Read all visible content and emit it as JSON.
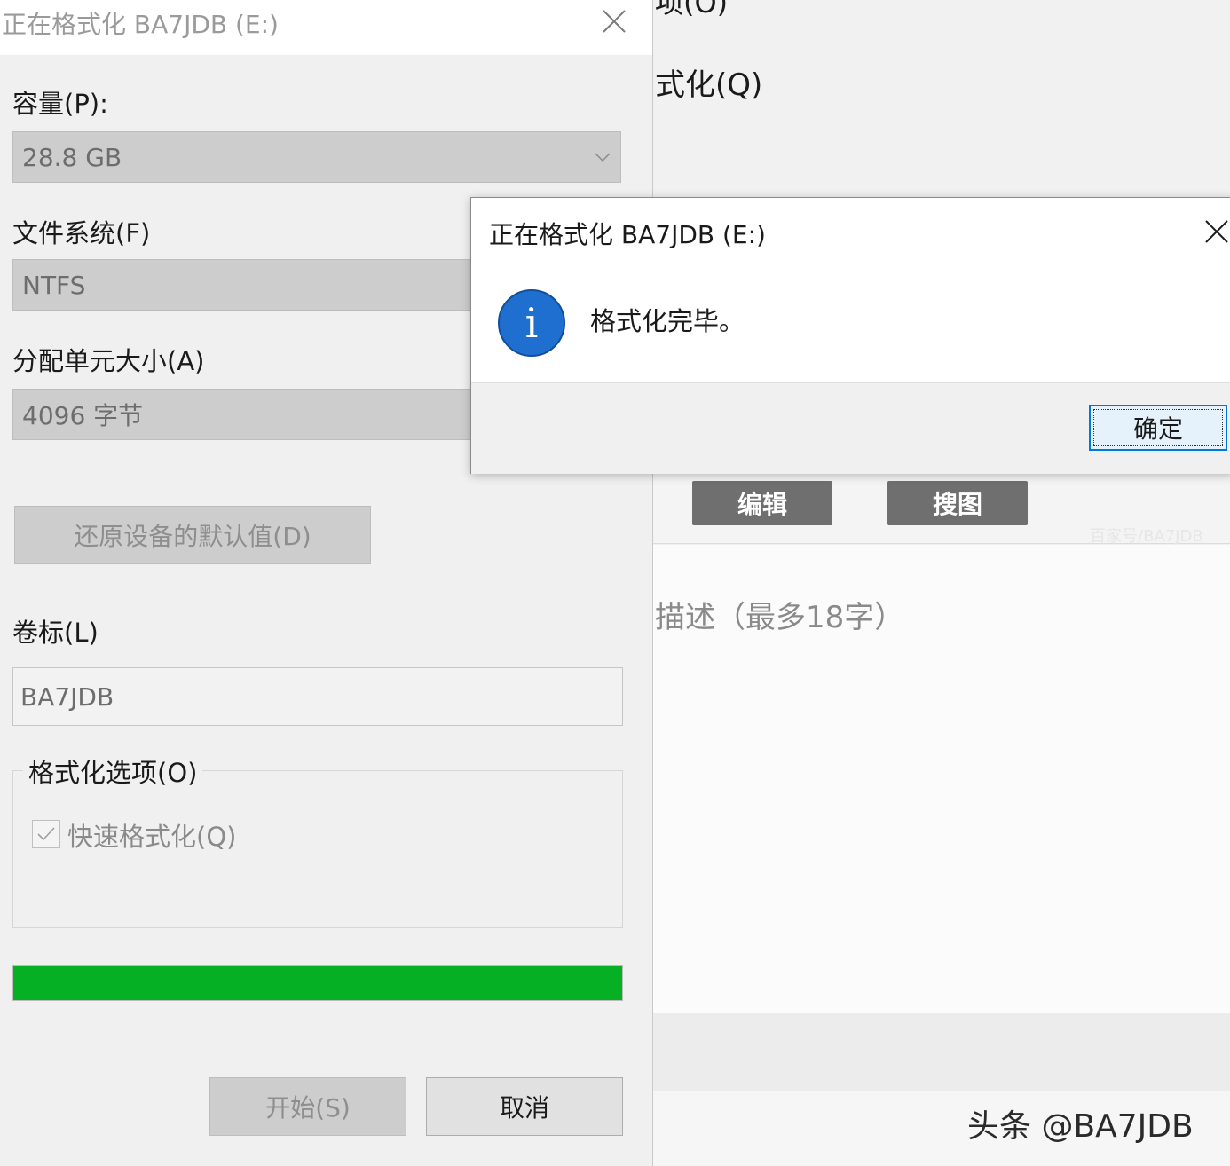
{
  "background_page": {
    "cut_top_text": "项(O)",
    "quick_format_text": "式化(Q)",
    "toolbar": {
      "edit_label": "编辑",
      "search_image_label": "搜图"
    },
    "watermark": "百家号/BA7JDB",
    "description_placeholder": "描述（最多18字）",
    "credit": "头条 @BA7JDB"
  },
  "format_dialog": {
    "title": "正在格式化 BA7JDB (E:)",
    "capacity_label": "容量(P):",
    "capacity_value": "28.8 GB",
    "filesystem_label": "文件系统(F)",
    "filesystem_value": "NTFS",
    "allocation_label": "分配单元大小(A)",
    "allocation_value": "4096 字节",
    "restore_defaults_label": "还原设备的默认值(D)",
    "volume_label_label": "卷标(L)",
    "volume_label_value": "BA7JDB",
    "options_group_label": "格式化选项(O)",
    "quick_format_label": "快速格式化(Q)",
    "quick_format_checked": true,
    "progress_percent": 100,
    "progress_color": "#06b025",
    "start_label": "开始(S)",
    "cancel_label": "取消"
  },
  "message_box": {
    "title": "正在格式化 BA7JDB (E:)",
    "icon": "info-icon",
    "icon_glyph": "i",
    "message": "格式化完毕。",
    "ok_label": "确定"
  }
}
